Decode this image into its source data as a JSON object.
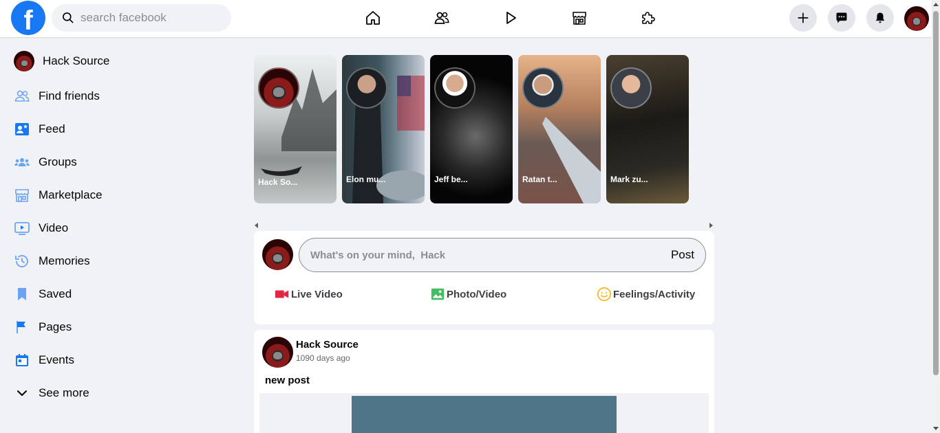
{
  "header": {
    "logo_letter": "f",
    "search_placeholder": "search facebook",
    "nav_icons": [
      "home-icon",
      "friends-icon",
      "video-icon",
      "marketplace-icon",
      "gaming-icon"
    ],
    "action_icons": [
      "plus-icon",
      "messenger-icon",
      "bell-icon"
    ]
  },
  "sidebar": {
    "profile_name": "Hack Source",
    "items": [
      {
        "label": "Find friends",
        "icon": "friends-icon"
      },
      {
        "label": "Feed",
        "icon": "feed-icon"
      },
      {
        "label": "Groups",
        "icon": "groups-icon"
      },
      {
        "label": "Marketplace",
        "icon": "marketplace-icon"
      },
      {
        "label": "Video",
        "icon": "video-icon"
      },
      {
        "label": "Memories",
        "icon": "memories-icon"
      },
      {
        "label": "Saved",
        "icon": "bookmark-icon"
      },
      {
        "label": "Pages",
        "icon": "flag-icon"
      },
      {
        "label": "Events",
        "icon": "calendar-icon"
      },
      {
        "label": "See more",
        "icon": "chevron-down-icon"
      }
    ]
  },
  "stories": [
    {
      "name": "Hack So..."
    },
    {
      "name": "Elon mu..."
    },
    {
      "name": "Jeff be..."
    },
    {
      "name": "Ratan t..."
    },
    {
      "name": "Mark zu..."
    }
  ],
  "composer": {
    "placeholder": "What's on your mind,  Hack",
    "post_label": "Post",
    "actions": [
      {
        "label": "Live Video",
        "icon": "live-video-icon",
        "color": "#e42645"
      },
      {
        "label": "Photo/Video",
        "icon": "photo-icon",
        "color": "#45bd62"
      },
      {
        "label": "Feelings/Activity",
        "icon": "smiley-icon",
        "color": "#f7b928"
      }
    ]
  },
  "post": {
    "author": "Hack Source",
    "time": "1090 days ago",
    "text": "new post"
  },
  "colors": {
    "brand": "#1877f2",
    "sidebar_icon": "#1877f2",
    "background": "#f0f2f5"
  }
}
